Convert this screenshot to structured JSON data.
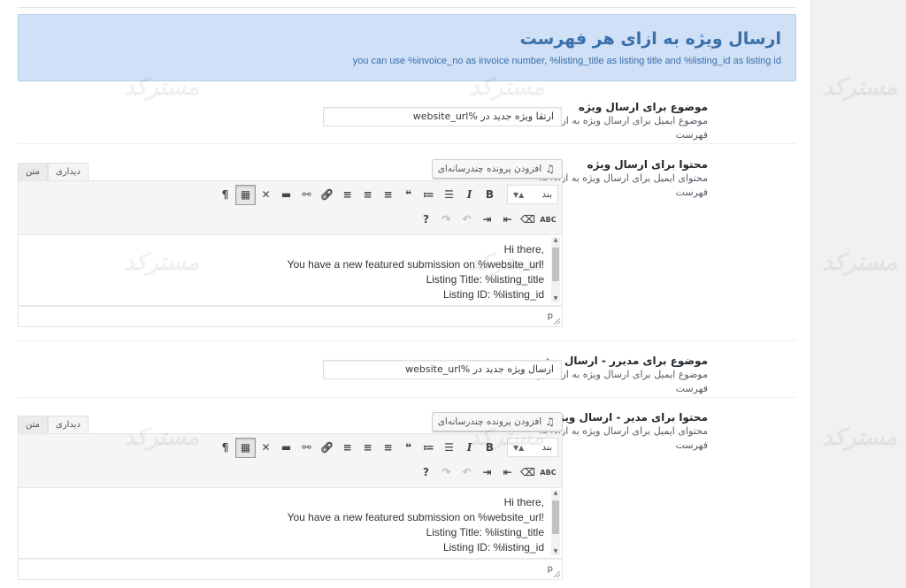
{
  "header": {
    "title": "ارسال ویژه به ازای هر فهرست",
    "subtitle": "you can use %invoice_no as invoice number, %listing_title as listing title and %listing_id as listing id"
  },
  "fields": {
    "subject": {
      "label": "موضوع برای ارسال ویژه",
      "description": "موضوع ایمیل برای ارسال ویژه به ازای هر فهرست",
      "value": "ارتقا ویژه جدید در %website_url"
    },
    "content": {
      "label": "محتوا برای ارسال ویژه",
      "description": "محتوای ایمیل برای ارسال ویژه به ازای هر فهرست"
    },
    "admin_subject": {
      "label": "موضوع برای مدیرر - ارسال ویژه",
      "description": "موضوع ایمیل برای ارسال ویژه به ازای هر فهرست",
      "value": "ارسال ویژه جدید در %website_url"
    },
    "admin_content": {
      "label": "محتوا برای مدیر - ارسال ویژه",
      "description": "محتوای ایمیل برای ارسال ویژه به ازای هر فهرست"
    }
  },
  "editor": {
    "tab_visual": "دیداری",
    "tab_text": "متن",
    "add_media": "افزودن پرونده چندرسانه‌ای",
    "format_select": "بند",
    "status_path": "p",
    "body_lines": [
      "Hi there,",
      "You have a new featured submission on %website_url!",
      "Listing Title: %listing_title",
      "Listing ID: %listing_id"
    ]
  },
  "watermark": "مسترکد"
}
